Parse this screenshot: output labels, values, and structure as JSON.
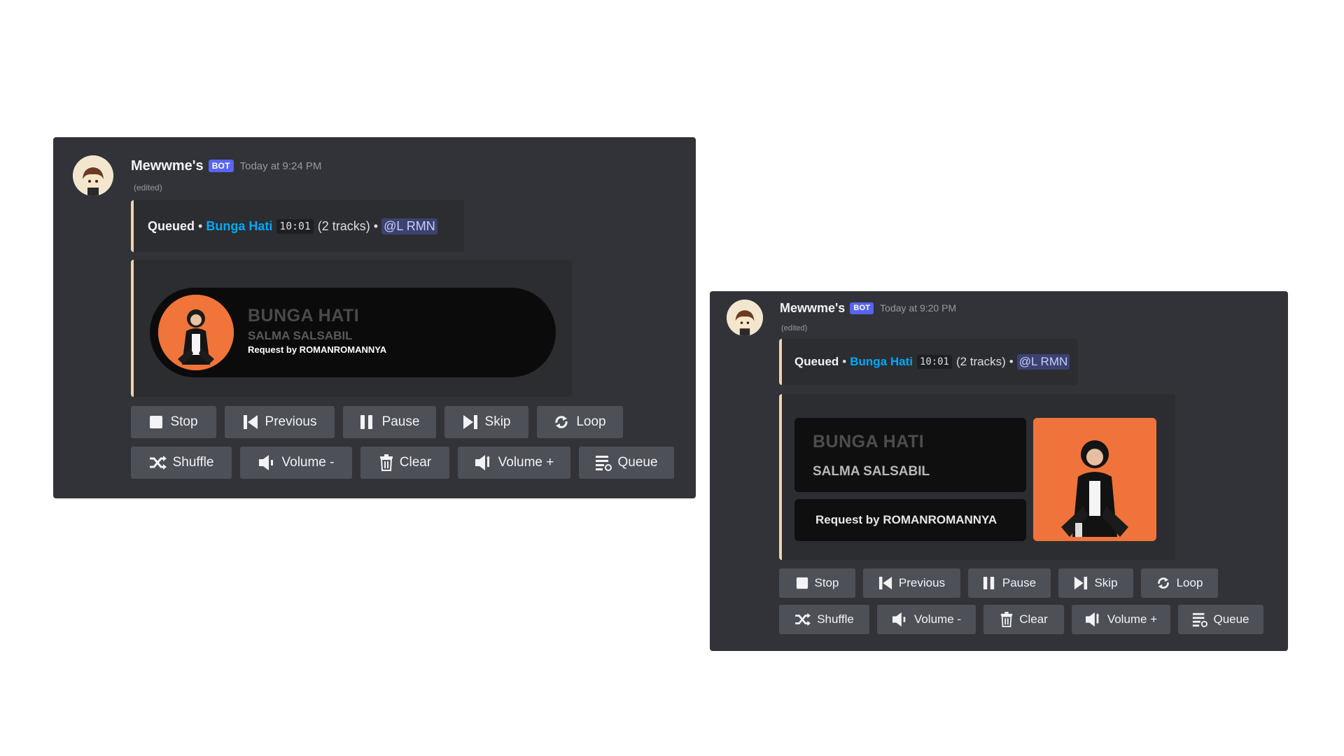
{
  "panels": [
    {
      "bot_name": "Mewwme's",
      "bot_tag": "BOT",
      "timestamp": "Today at 9:24 PM",
      "edited": "(edited)",
      "queued": {
        "label": "Queued",
        "bullet": "•",
        "track": "Bunga Hati",
        "duration": "10:01",
        "tracks_count": "(2 tracks)",
        "mention": "@L RMN"
      },
      "card": {
        "title": "BUNGA HATI",
        "artist": "SALMA SALSABIL",
        "requester": "Request by ROMANROMANNYA"
      },
      "row1": [
        {
          "icon": "stop-icon",
          "label": "Stop"
        },
        {
          "icon": "previous-icon",
          "label": "Previous"
        },
        {
          "icon": "pause-icon",
          "label": "Pause"
        },
        {
          "icon": "skip-icon",
          "label": "Skip"
        },
        {
          "icon": "loop-icon",
          "label": "Loop"
        }
      ],
      "row2": [
        {
          "icon": "shuffle-icon",
          "label": "Shuffle"
        },
        {
          "icon": "volume-down-icon",
          "label": "Volume -"
        },
        {
          "icon": "trash-icon",
          "label": "Clear"
        },
        {
          "icon": "volume-up-icon",
          "label": "Volume +"
        },
        {
          "icon": "queue-icon",
          "label": "Queue"
        }
      ]
    },
    {
      "bot_name": "Mewwme's",
      "bot_tag": "BOT",
      "timestamp": "Today at 9:20 PM",
      "edited": "(edited)",
      "queued": {
        "label": "Queued",
        "bullet": "•",
        "track": "Bunga Hati",
        "duration": "10:01",
        "tracks_count": "(2 tracks)",
        "mention": "@L RMN"
      },
      "card": {
        "title": "BUNGA HATI",
        "artist": "SALMA SALSABIL",
        "requester": "Request by ROMANROMANNYA"
      },
      "row1": [
        {
          "icon": "stop-icon",
          "label": "Stop"
        },
        {
          "icon": "previous-icon",
          "label": "Previous"
        },
        {
          "icon": "pause-icon",
          "label": "Pause"
        },
        {
          "icon": "skip-icon",
          "label": "Skip"
        },
        {
          "icon": "loop-icon",
          "label": "Loop"
        }
      ],
      "row2": [
        {
          "icon": "shuffle-icon",
          "label": "Shuffle"
        },
        {
          "icon": "volume-down-icon",
          "label": "Volume -"
        },
        {
          "icon": "trash-icon",
          "label": "Clear"
        },
        {
          "icon": "volume-up-icon",
          "label": "Volume +"
        },
        {
          "icon": "queue-icon",
          "label": "Queue"
        }
      ]
    }
  ],
  "colors": {
    "panel_bg": "#313338",
    "embed_bg": "#2b2d31",
    "embed_border": "#e9d5b5",
    "button_bg": "#4e5058",
    "bot_tag": "#5865f2",
    "link": "#00a8fc",
    "artwork_orange": "#f1743a"
  }
}
